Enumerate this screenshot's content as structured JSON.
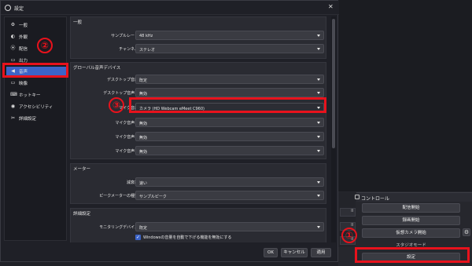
{
  "window": {
    "title": "設定",
    "close_glyph": "✕"
  },
  "sidebar": {
    "items": [
      {
        "icon": "settings-icon",
        "glyph": "⚙",
        "label": "一般"
      },
      {
        "icon": "appearance-icon",
        "glyph": "◐",
        "label": "外観"
      },
      {
        "icon": "stream-icon",
        "glyph": "⦿",
        "label": "配信"
      },
      {
        "icon": "output-icon",
        "glyph": "▭",
        "label": "出力"
      },
      {
        "icon": "audio-icon",
        "glyph": "◀",
        "label": "音声",
        "active": true
      },
      {
        "icon": "video-icon",
        "glyph": "▭",
        "label": "映像"
      },
      {
        "icon": "hotkeys-icon",
        "glyph": "⌨",
        "label": "ホットキー"
      },
      {
        "icon": "accessibility-icon",
        "glyph": "◉",
        "label": "アクセシビリティ"
      },
      {
        "icon": "advanced-icon",
        "glyph": "✂",
        "label": "詳細設定"
      }
    ]
  },
  "general": {
    "title": "一般",
    "sample_rate_label": "サンプルレート",
    "sample_rate_value": "48 kHz",
    "channels_label": "チャンネル",
    "channels_value": "ステレオ"
  },
  "global_audio": {
    "title": "グローバル音声デバイス",
    "rows": [
      {
        "label": "デスクトップ音声",
        "value": "既定"
      },
      {
        "label": "デスクトップ音声 2",
        "value": "無効"
      },
      {
        "label": "マイク音声",
        "value": "カメラ (HD Webcam eMeet C960)"
      },
      {
        "label": "マイク音声 2",
        "value": "無効"
      },
      {
        "label": "マイク音声 3",
        "value": "無効"
      },
      {
        "label": "マイク音声 4",
        "value": "無効"
      }
    ]
  },
  "meters": {
    "title": "メーター",
    "decay_label": "減衰率",
    "decay_value": "速い",
    "peak_label": "ピークメーターの種類",
    "peak_value": "サンプルピーク"
  },
  "advanced": {
    "title": "詳細設定",
    "monitoring_label": "モニタリングデバイス",
    "monitoring_value": "既定",
    "ducking_label": "Windowsの音量を自動で下げる機能を無効にする",
    "ducking_check": "✓"
  },
  "buttons": {
    "ok": "OK",
    "cancel": "キャンセル",
    "apply": "適用"
  },
  "background": {
    "controls_title": "コントロール",
    "start_streaming": "配信開始",
    "start_recording": "録画開始",
    "virtual_camera": "仮想カメラ開始",
    "studio_mode": "スタジオモード",
    "settings": "設定",
    "gear_glyph": "⚙",
    "mid_rows": [
      "ll",
      "ll",
      "ll"
    ]
  },
  "annotations": {
    "one": "①",
    "two": "②",
    "three": "③",
    "color": "#e8121c"
  },
  "colors": {
    "accent": "#3c64c8",
    "dialog_bg": "#1f2027",
    "panel_bg": "#2a2b32",
    "combo_bg": "#3a3b42"
  }
}
